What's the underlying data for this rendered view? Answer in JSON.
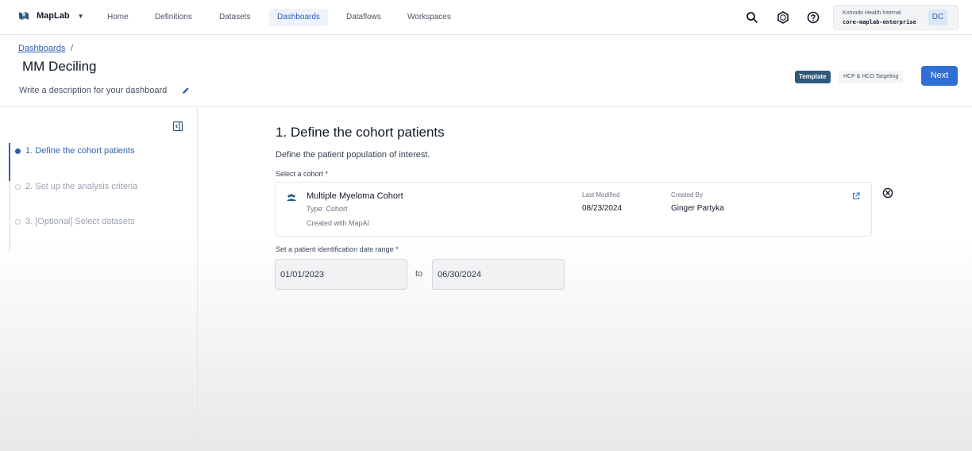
{
  "topnav": {
    "brand": "MapLab",
    "items": [
      {
        "label": "Home"
      },
      {
        "label": "Definitions"
      },
      {
        "label": "Datasets"
      },
      {
        "label": "Dashboards"
      },
      {
        "label": "Dataflows"
      },
      {
        "label": "Workspaces"
      }
    ],
    "active_item": "Dashboards",
    "icons": [
      "search-icon",
      "hexagon-icon",
      "help-icon"
    ],
    "account": {
      "org": "Komodo Health Internal",
      "instance": "core-maplab-enterprise",
      "initials": "DC"
    }
  },
  "header": {
    "breadcrumb": "Dashboards",
    "breadcrumb_sep": "/",
    "title": "MM Deciling",
    "description_placeholder": "Write a description for your dashboard",
    "template_badge": "Template",
    "template_name": "HCP & HCO Targeting",
    "next_label": "Next"
  },
  "sidebar": {
    "steps": [
      {
        "label": "1. Define the cohort patients",
        "active": true
      },
      {
        "label": "2. Set up the analysis criteria",
        "active": false
      },
      {
        "label": "3. [Optional] Select datasets",
        "active": false
      }
    ]
  },
  "main": {
    "section_title": "1. Define the cohort patients",
    "section_desc": "Define the patient population of interest.",
    "cohort_label": "Select a cohort *",
    "cohort": {
      "name": "Multiple Myeloma Cohort",
      "type": "Type: Cohort",
      "created_with": "Created with MapAI",
      "last_modified_label": "Last Modified",
      "last_modified": "08/23/2024",
      "created_by_label": "Created By",
      "created_by": "Ginger Partyka"
    },
    "date_range_label": "Set a patient identification date range *",
    "date_from": "01/01/2023",
    "date_to_sep": "to",
    "date_to": "06/30/2024"
  },
  "colors": {
    "accent": "#2f5fb3",
    "next_button": "#2f6fd6",
    "template_badge": "#2f5a7a"
  }
}
